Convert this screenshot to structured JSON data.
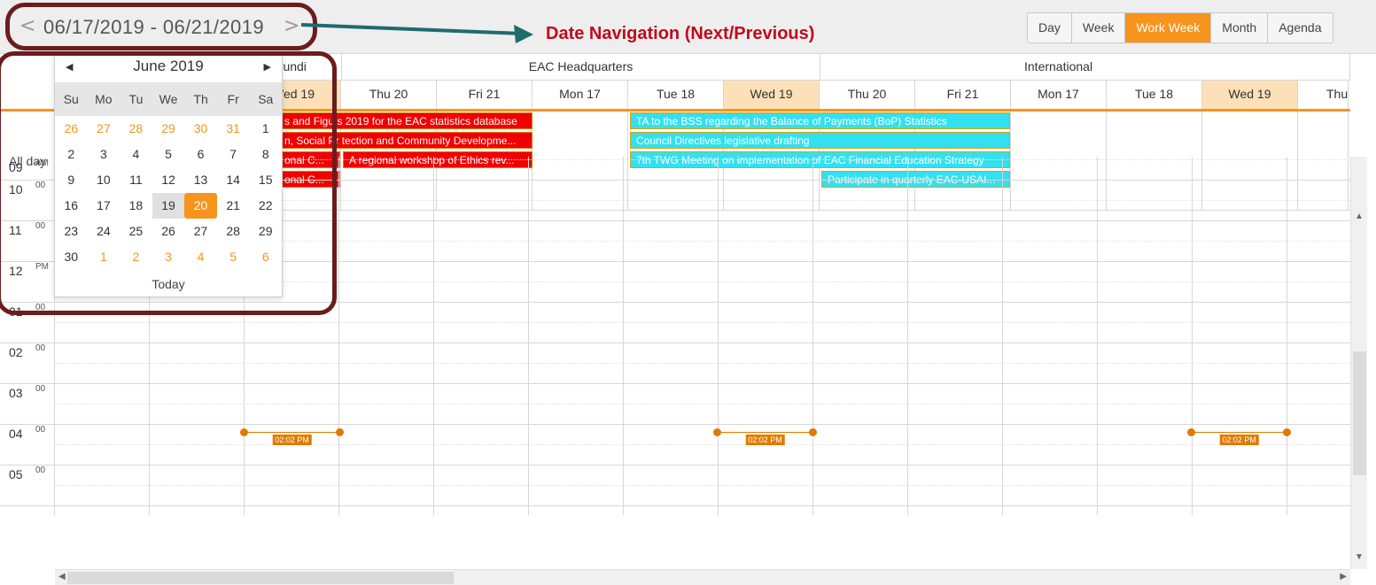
{
  "toolbar": {
    "date_range": "06/17/2019 - 06/21/2019",
    "annotation": "Date Navigation (Next/Previous)",
    "views": [
      "Day",
      "Week",
      "Work Week",
      "Month",
      "Agenda"
    ],
    "active_view": "Work Week"
  },
  "resources": [
    "urundi",
    "EAC Headquarters",
    "International"
  ],
  "days": [
    "Wed 19",
    "Thu 20",
    "Fri 21",
    "Mon 17",
    "Tue 18",
    "Wed 19",
    "Thu 20",
    "Fri 21",
    "Mon 17",
    "Tue 18",
    "Wed 19",
    "Thu"
  ],
  "allday_label": "All day",
  "events": [
    "s and Figu  s 2019 for the EAC statistics database",
    "n, Social Pr  tection and Community Developme...",
    "onal C...",
    "A regional workshop of Ethics rev...",
    "onal C...",
    "TA to the BSS regarding the Balance of Payments (BoP) Statistics",
    "Council Directives legislative drafting",
    "7th TWG Meeting on implementation of EAC Financial Education Strategy",
    "Participate in quarterly EAC-USAI..."
  ],
  "times": [
    {
      "hour": "09",
      "min": "AM"
    },
    {
      "hour": "10",
      "min": "00"
    },
    {
      "hour": "11",
      "min": "00"
    },
    {
      "hour": "12",
      "min": "PM"
    },
    {
      "hour": "01",
      "min": "00"
    },
    {
      "hour": "02",
      "min": "00"
    },
    {
      "hour": "03",
      "min": "00"
    },
    {
      "hour": "04",
      "min": "00"
    },
    {
      "hour": "05",
      "min": "00"
    }
  ],
  "current_time": "02:02 PM",
  "calendar": {
    "title": "June 2019",
    "weekdays": [
      "Su",
      "Mo",
      "Tu",
      "We",
      "Th",
      "Fr",
      "Sa"
    ],
    "days": [
      "26",
      "27",
      "28",
      "29",
      "30",
      "31",
      "1",
      "2",
      "3",
      "4",
      "5",
      "6",
      "7",
      "8",
      "9",
      "10",
      "11",
      "12",
      "13",
      "14",
      "15",
      "16",
      "17",
      "18",
      "19",
      "20",
      "21",
      "22",
      "23",
      "24",
      "25",
      "26",
      "27",
      "28",
      "29",
      "30",
      "1",
      "2",
      "3",
      "4",
      "5",
      "6"
    ],
    "today_label": "Today",
    "accent": "#f7941d"
  }
}
